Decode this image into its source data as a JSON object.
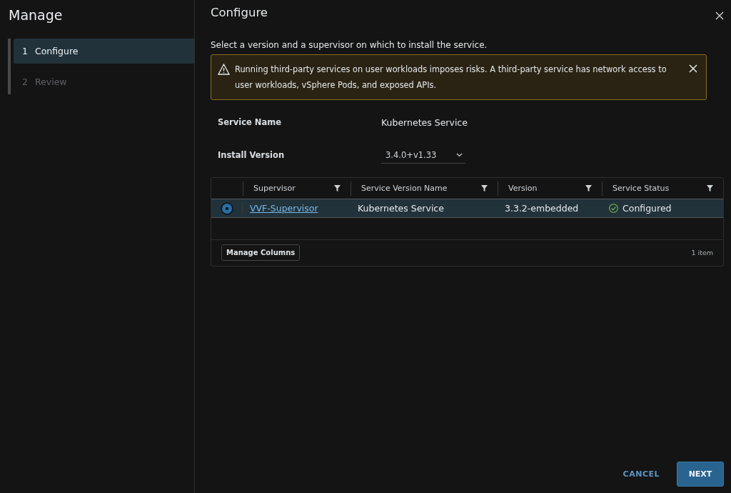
{
  "sidebar": {
    "title": "Manage",
    "steps": [
      {
        "number": "1",
        "label": "Configure",
        "selected": true
      },
      {
        "number": "2",
        "label": "Review",
        "selected": false
      }
    ]
  },
  "main": {
    "title": "Configure",
    "description": "Select a version and a supervisor on which to install the service.",
    "alert": {
      "text": "Running third-party services on user workloads imposes risks. A third-party service has network access to user workloads, vSphere Pods, and exposed APIs."
    },
    "fields": [
      {
        "label": "Service Name",
        "kind": "text",
        "value": "Kubernetes Service"
      },
      {
        "label": "Install Version",
        "kind": "select",
        "value": "3.4.0+v1.33"
      }
    ],
    "table": {
      "columns": [
        "Supervisor",
        "Service Version Name",
        "Version",
        "Service Status"
      ],
      "rows": [
        {
          "selected": true,
          "supervisor": "VVF-Supervisor",
          "service_version_name": "Kubernetes Service",
          "version": "3.3.2-embedded",
          "service_status": "Configured"
        }
      ],
      "manage_columns": "Manage Columns",
      "count": "1 item"
    },
    "buttons": {
      "cancel": "CANCEL",
      "next": "NEXT"
    }
  }
}
